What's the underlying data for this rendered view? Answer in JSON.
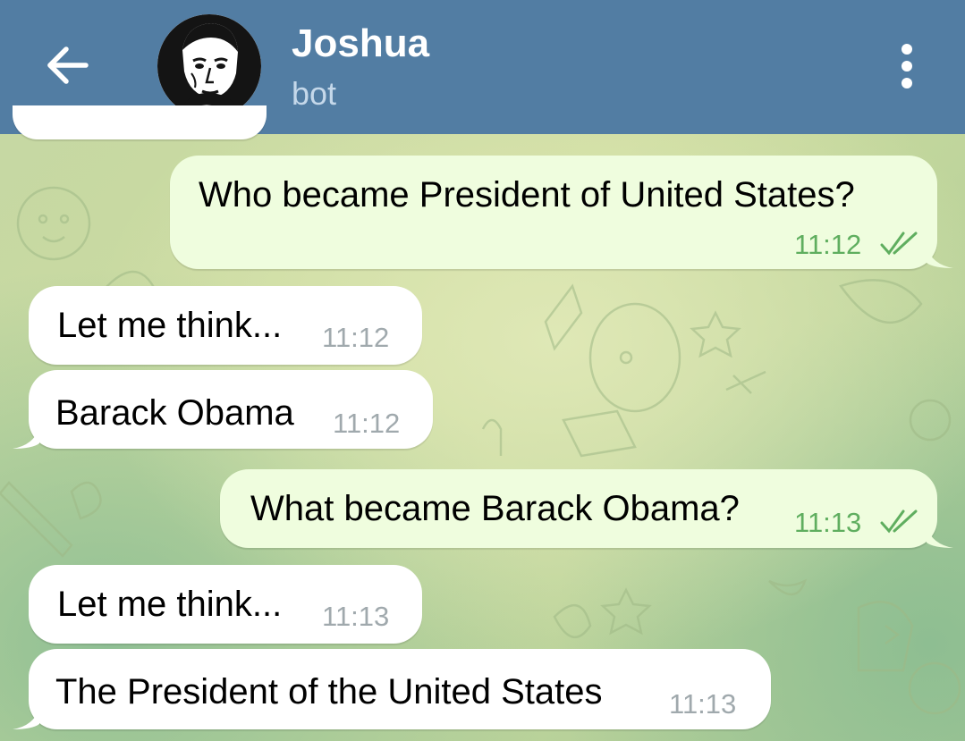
{
  "header": {
    "back_icon": "arrow-left-icon",
    "title": "Joshua",
    "subtitle": "bot",
    "menu_icon": "more-vertical-icon"
  },
  "colors": {
    "header": "#527da3",
    "outgoing_bubble": "#effdde",
    "incoming_bubble": "#ffffff",
    "outgoing_time": "#5fae5f",
    "incoming_time": "#a0a9ad"
  },
  "messages": [
    {
      "direction": "out",
      "text": "Who became President of United States?",
      "time": "11:12",
      "status_icon": "double-check-icon"
    },
    {
      "direction": "in",
      "text": "Let me think...",
      "time": "11:12"
    },
    {
      "direction": "in",
      "text": "Barack Obama",
      "time": "11:12"
    },
    {
      "direction": "out",
      "text": "What became Barack Obama?",
      "time": "11:13",
      "status_icon": "double-check-icon"
    },
    {
      "direction": "in",
      "text": "Let me think...",
      "time": "11:13"
    },
    {
      "direction": "in",
      "text": "The President of the United States",
      "time": "11:13"
    }
  ]
}
